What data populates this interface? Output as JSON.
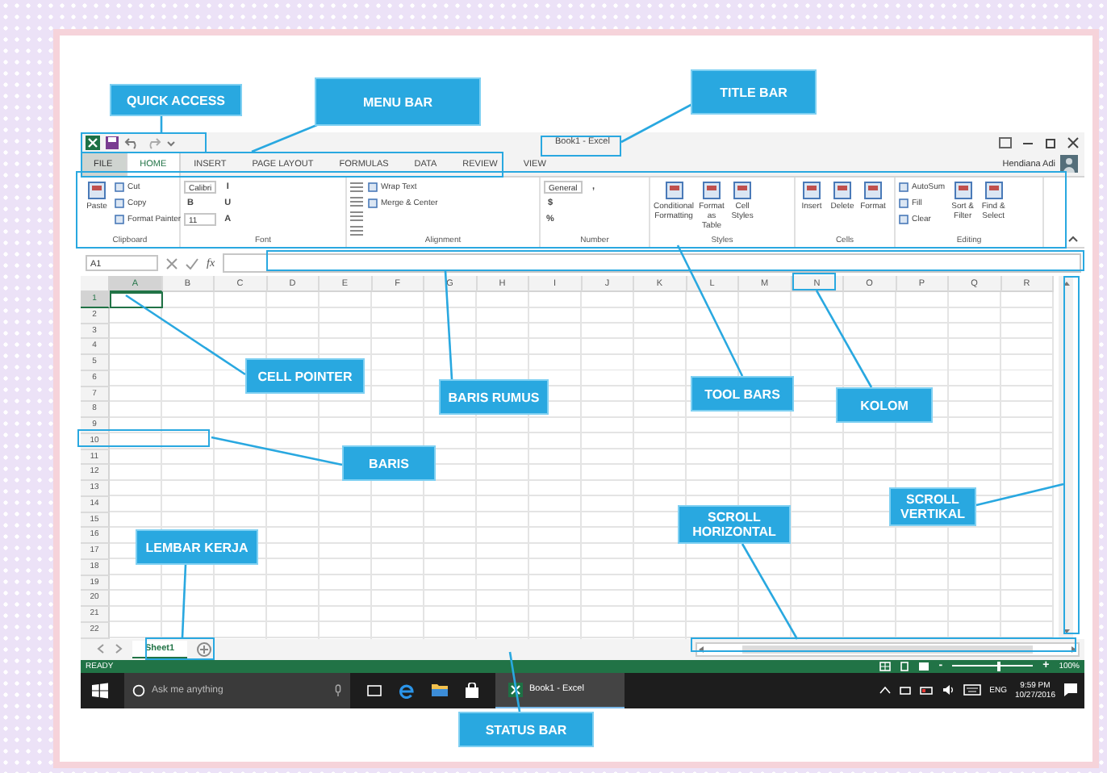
{
  "annotations": [
    {
      "text": "QUICK ACCESS"
    },
    {
      "text": "MENU BAR"
    },
    {
      "text": "TITLE BAR"
    },
    {
      "text": "CELL POINTER"
    },
    {
      "text": "BARIS RUMUS"
    },
    {
      "text": "TOOL BARS"
    },
    {
      "text": "KOLOM"
    },
    {
      "text": "BARIS"
    },
    {
      "text": "LEMBAR KERJA"
    },
    {
      "text": "SCROLL HORIZONTAL"
    },
    {
      "text": "SCROLL VERTIKAL"
    },
    {
      "text": "STATUS BAR"
    }
  ],
  "window": {
    "title": "Book1 - Excel",
    "user": "Hendiana Adi"
  },
  "tabs": [
    {
      "label": "FILE",
      "kind": "file",
      "selected": false
    },
    {
      "label": "HOME",
      "kind": "tab",
      "selected": true
    },
    {
      "label": "INSERT",
      "kind": "tab",
      "selected": false
    },
    {
      "label": "PAGE LAYOUT",
      "kind": "tab",
      "selected": false
    },
    {
      "label": "FORMULAS",
      "kind": "tab",
      "selected": false
    },
    {
      "label": "DATA",
      "kind": "tab",
      "selected": false
    },
    {
      "label": "REVIEW",
      "kind": "tab",
      "selected": false
    },
    {
      "label": "VIEW",
      "kind": "tab",
      "selected": false
    }
  ],
  "ribbon": [
    {
      "label": "Clipboard",
      "items": [
        {
          "kind": "large",
          "text": "Paste"
        },
        {
          "kind": "small",
          "text": "Cut"
        },
        {
          "kind": "small",
          "text": "Copy"
        },
        {
          "kind": "small",
          "text": "Format Painter"
        }
      ]
    },
    {
      "label": "Font",
      "items": [
        {
          "kind": "field",
          "text": "Calibri"
        },
        {
          "kind": "glyph",
          "text": "B"
        },
        {
          "kind": "field",
          "text": "11"
        },
        {
          "kind": "glyph",
          "text": "I"
        },
        {
          "kind": "glyph",
          "text": "U"
        },
        {
          "kind": "glyph",
          "text": "A"
        }
      ]
    },
    {
      "label": "Alignment",
      "items": [
        {
          "kind": "icon"
        },
        {
          "kind": "icon"
        },
        {
          "kind": "icon"
        },
        {
          "kind": "icon"
        },
        {
          "kind": "small",
          "text": "Wrap Text"
        },
        {
          "kind": "small",
          "text": "Merge & Center"
        }
      ]
    },
    {
      "label": "Number",
      "items": [
        {
          "kind": "field",
          "text": "General"
        },
        {
          "kind": "glyph",
          "text": "$"
        },
        {
          "kind": "glyph",
          "text": "%"
        },
        {
          "kind": "glyph",
          "text": ","
        }
      ]
    },
    {
      "label": "Styles",
      "items": [
        {
          "kind": "large",
          "text": "Conditional Formatting"
        },
        {
          "kind": "large",
          "text": "Format as Table"
        },
        {
          "kind": "large",
          "text": "Cell Styles"
        }
      ]
    },
    {
      "label": "Cells",
      "items": [
        {
          "kind": "large",
          "text": "Insert"
        },
        {
          "kind": "large",
          "text": "Delete"
        },
        {
          "kind": "large",
          "text": "Format"
        }
      ]
    },
    {
      "label": "Editing",
      "items": [
        {
          "kind": "small",
          "text": "AutoSum"
        },
        {
          "kind": "small",
          "text": "Fill"
        },
        {
          "kind": "small",
          "text": "Clear"
        },
        {
          "kind": "large",
          "text": "Sort & Filter"
        },
        {
          "kind": "large",
          "text": "Find & Select"
        }
      ]
    }
  ],
  "formula_bar": {
    "name_box": "A1",
    "fx": "fx"
  },
  "columns": [
    {
      "label": "A",
      "selected": true
    },
    {
      "label": "B",
      "selected": false
    },
    {
      "label": "C",
      "selected": false
    },
    {
      "label": "D",
      "selected": false
    },
    {
      "label": "E",
      "selected": false
    },
    {
      "label": "F",
      "selected": false
    },
    {
      "label": "G",
      "selected": false
    },
    {
      "label": "H",
      "selected": false
    },
    {
      "label": "I",
      "selected": false
    },
    {
      "label": "J",
      "selected": false
    },
    {
      "label": "K",
      "selected": false
    },
    {
      "label": "L",
      "selected": false
    },
    {
      "label": "M",
      "selected": false
    },
    {
      "label": "N",
      "selected": false
    },
    {
      "label": "O",
      "selected": false
    },
    {
      "label": "P",
      "selected": false
    },
    {
      "label": "Q",
      "selected": false
    },
    {
      "label": "R",
      "selected": false
    }
  ],
  "rows": [
    {
      "label": "1",
      "selected": true
    },
    {
      "label": "2",
      "selected": false
    },
    {
      "label": "3",
      "selected": false
    },
    {
      "label": "4",
      "selected": false
    },
    {
      "label": "5",
      "selected": false
    },
    {
      "label": "6",
      "selected": false
    },
    {
      "label": "7",
      "selected": false
    },
    {
      "label": "8",
      "selected": false
    },
    {
      "label": "9",
      "selected": false
    },
    {
      "label": "10",
      "selected": false
    },
    {
      "label": "11",
      "selected": false
    },
    {
      "label": "12",
      "selected": false
    },
    {
      "label": "13",
      "selected": false
    },
    {
      "label": "14",
      "selected": false
    },
    {
      "label": "15",
      "selected": false
    },
    {
      "label": "16",
      "selected": false
    },
    {
      "label": "17",
      "selected": false
    },
    {
      "label": "18",
      "selected": false
    },
    {
      "label": "19",
      "selected": false
    },
    {
      "label": "20",
      "selected": false
    },
    {
      "label": "21",
      "selected": false
    },
    {
      "label": "22",
      "selected": false
    }
  ],
  "sheets": [
    {
      "label": "Sheet1",
      "selected": true
    }
  ],
  "status_bar": {
    "status": "READY",
    "zoom": {
      "out": "-",
      "in": "+",
      "level": 0.55,
      "reading": "100%"
    }
  },
  "taskbar": {
    "search_placeholder": "Ask me anything",
    "app": "Book1 - Excel",
    "language": "ENG",
    "time": "9:59 PM",
    "date": "10/27/2016"
  }
}
